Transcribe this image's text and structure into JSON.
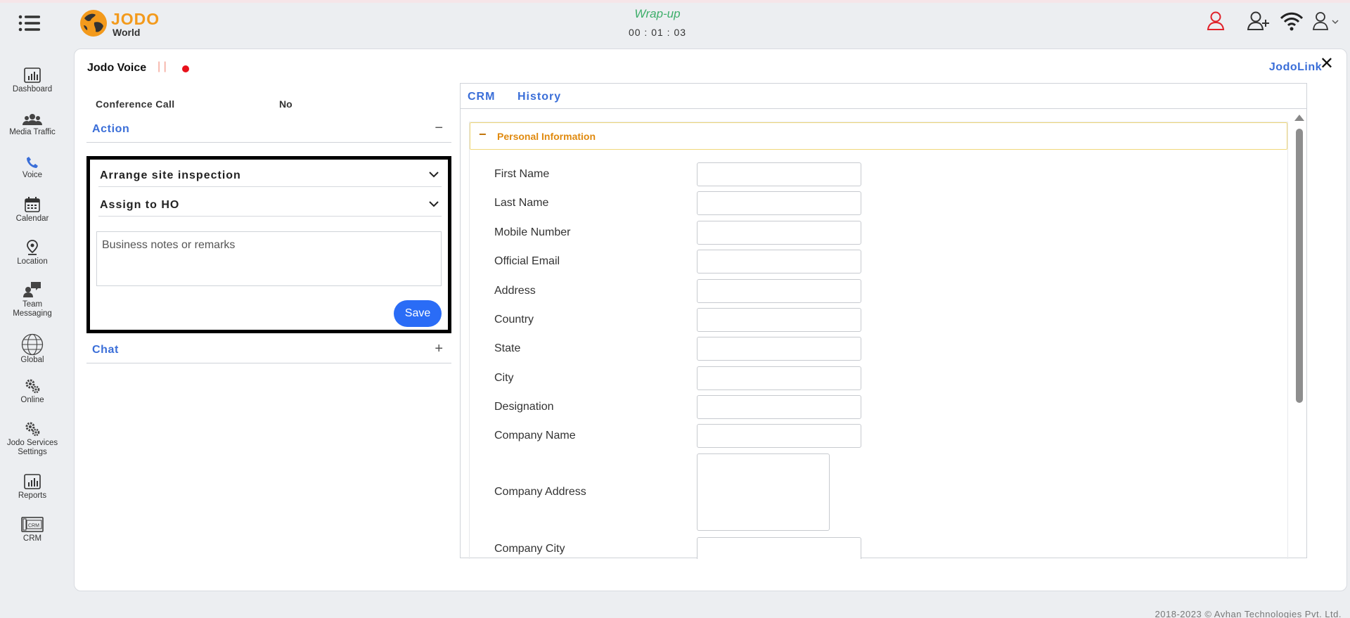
{
  "header": {
    "brand_primary": "JODO",
    "brand_secondary": "World",
    "call_state": "Wrap-up",
    "call_timer": "00 : 01 : 03"
  },
  "sidebar": {
    "items": [
      {
        "label": "Dashboard",
        "icon": "dashboard-icon"
      },
      {
        "label": "Media Traffic",
        "icon": "users-icon"
      },
      {
        "label": "Voice",
        "icon": "phone-icon"
      },
      {
        "label": "Calendar",
        "icon": "calendar-icon"
      },
      {
        "label": "Location",
        "icon": "location-pin-icon"
      },
      {
        "label": "Team Messaging",
        "icon": "team-chat-icon"
      },
      {
        "label": "Global",
        "icon": "globe-icon"
      },
      {
        "label": "Online",
        "icon": "gears-icon"
      },
      {
        "label": "Jodo Services Settings",
        "icon": "settings-gears-icon"
      },
      {
        "label": "Reports",
        "icon": "reports-icon"
      },
      {
        "label": "CRM",
        "icon": "crm-icon"
      }
    ]
  },
  "panel": {
    "title": "Jodo Voice",
    "bars": "| |",
    "jodolink": "JodoLink",
    "conference_label": "Conference Call",
    "conference_value": "No",
    "action_title": "Action",
    "action_toggle": "−",
    "action_select_1": "Arrange site inspection",
    "action_select_2": "Assign to HO",
    "notes_placeholder": "Business notes or remarks",
    "save_label": "Save",
    "chat_title": "Chat",
    "chat_toggle": "+"
  },
  "crm": {
    "tabs": [
      "CRM",
      "History"
    ],
    "section_toggle": "−",
    "section_title": "Personal Information",
    "fields": [
      "First Name",
      "Last Name",
      "Mobile Number",
      "Official Email",
      "Address",
      "Country",
      "State",
      "City",
      "Designation",
      "Company Name",
      "Company Address",
      "Company City"
    ]
  },
  "footer": {
    "copyright": "2018-2023 © Avhan Technologies Pvt. Ltd."
  },
  "colors": {
    "accent_blue": "#3a6ed8",
    "brand_orange": "#f39a1c",
    "wrapup_green": "#3dae6a",
    "save_blue": "#2a6cf6",
    "section_orange": "#e08a0f"
  }
}
